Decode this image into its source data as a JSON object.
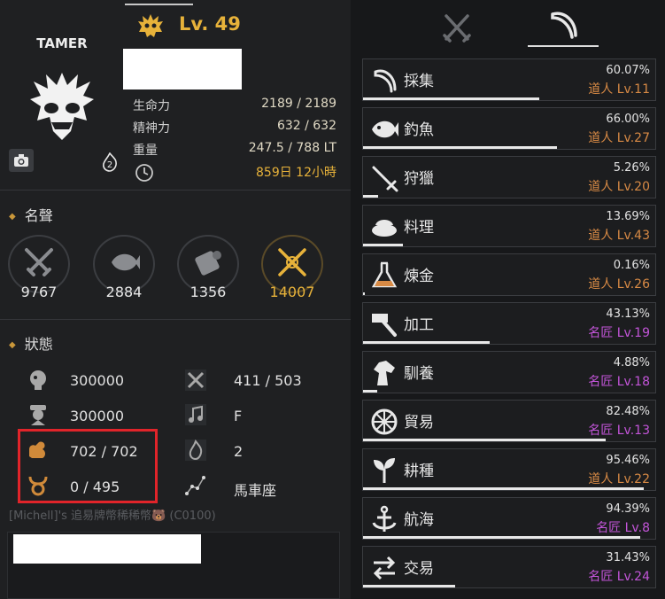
{
  "character": {
    "class": "TAMER",
    "level": "Lv. 49",
    "stats": [
      {
        "label": "生命力",
        "value": "2189 / 2189"
      },
      {
        "label": "精神力",
        "value": "632 / 632"
      },
      {
        "label": "重量",
        "value": "247.5 / 788 LT"
      },
      {
        "label": "",
        "value": "859日 12小時"
      }
    ],
    "awakening_badge": "2"
  },
  "fame": {
    "title": "名聲",
    "items": [
      {
        "icon": "swords-icon",
        "value": "9767"
      },
      {
        "icon": "fish-icon",
        "value": "2884"
      },
      {
        "icon": "scroll-icon",
        "value": "1356"
      },
      {
        "icon": "crossed-gold-icon",
        "value": "14007"
      }
    ]
  },
  "status": {
    "title": "狀態",
    "left": [
      {
        "icon": "head-icon",
        "value": "300000"
      },
      {
        "icon": "officer-icon",
        "value": "300000"
      },
      {
        "icon": "arm-strength-icon",
        "value": "702 / 702"
      },
      {
        "icon": "ox-icon",
        "value": "0 / 495"
      }
    ],
    "right": [
      {
        "icon": "tools-icon",
        "value": "411 / 503"
      },
      {
        "icon": "music-note-icon",
        "value": "F"
      },
      {
        "icon": "flame-icon",
        "value": "2"
      },
      {
        "icon": "constellation-icon",
        "value": "馬車座"
      }
    ]
  },
  "bottom_text": "[Michell]'s 追易牌幣稀稀幣🐻 (C0100)",
  "tabs": [
    {
      "icon": "crossed-swords-icon"
    },
    {
      "icon": "sickle-icon"
    }
  ],
  "life_skills": [
    {
      "icon": "sickle-icon",
      "name": "採集",
      "percent": "60.07%",
      "grade": "道人 Lv.11",
      "tier": "apprentice",
      "progress": 0.6007
    },
    {
      "icon": "fish-icon",
      "name": "釣魚",
      "percent": "66.00%",
      "grade": "道人 Lv.27",
      "tier": "apprentice",
      "progress": 0.66
    },
    {
      "icon": "dagger-icon",
      "name": "狩獵",
      "percent": "5.26%",
      "grade": "道人 Lv.20",
      "tier": "apprentice",
      "progress": 0.0526
    },
    {
      "icon": "roast-icon",
      "name": "料理",
      "percent": "13.69%",
      "grade": "道人 Lv.43",
      "tier": "apprentice",
      "progress": 0.1369
    },
    {
      "icon": "flask-icon",
      "name": "煉金",
      "percent": "0.16%",
      "grade": "道人 Lv.26",
      "tier": "apprentice",
      "progress": 0.0016
    },
    {
      "icon": "hammer-icon",
      "name": "加工",
      "percent": "43.13%",
      "grade": "名匠 Lv.19",
      "tier": "master",
      "progress": 0.4313
    },
    {
      "icon": "horse-icon",
      "name": "馴養",
      "percent": "4.88%",
      "grade": "名匠 Lv.18",
      "tier": "master",
      "progress": 0.0488
    },
    {
      "icon": "wheel-icon",
      "name": "貿易",
      "percent": "82.48%",
      "grade": "名匠 Lv.13",
      "tier": "master",
      "progress": 0.8248
    },
    {
      "icon": "sprout-icon",
      "name": "耕種",
      "percent": "95.46%",
      "grade": "道人 Lv.22",
      "tier": "apprentice",
      "progress": 0.9546
    },
    {
      "icon": "anchor-icon",
      "name": "航海",
      "percent": "94.39%",
      "grade": "名匠 Lv.8",
      "tier": "master",
      "progress": 0.9439
    },
    {
      "icon": "exchange-icon",
      "name": "交易",
      "percent": "31.43%",
      "grade": "名匠 Lv.24",
      "tier": "master",
      "progress": 0.3143
    }
  ],
  "colors": {
    "gold": "#e7b23a",
    "apprentice": "#d88a45",
    "master": "#c355d9",
    "alert": "#e1242a"
  }
}
